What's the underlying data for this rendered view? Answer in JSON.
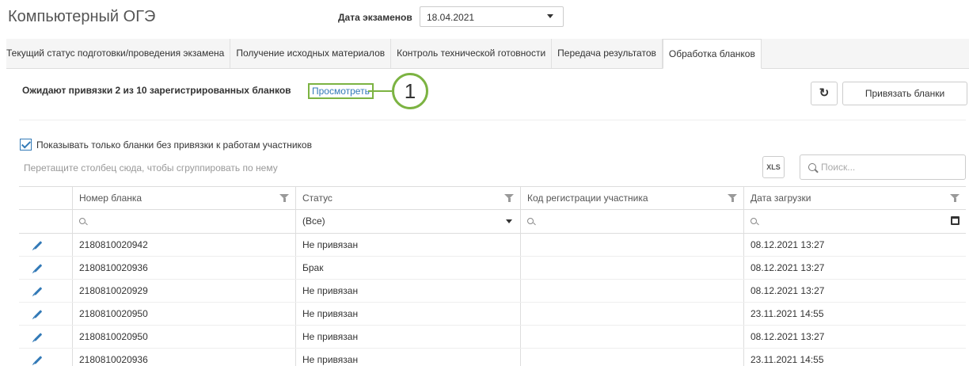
{
  "header": {
    "app_title": "Компьютерный ОГЭ",
    "date_label": "Дата экзаменов",
    "date_value": "18.04.2021"
  },
  "tabs": [
    {
      "label": "Текущий статус подготовки/проведения экзамена",
      "active": false
    },
    {
      "label": "Получение исходных материалов",
      "active": false
    },
    {
      "label": "Контроль технической готовности",
      "active": false
    },
    {
      "label": "Передача результатов",
      "active": false
    },
    {
      "label": "Обработка бланков",
      "active": true
    }
  ],
  "panel": {
    "pending_text": "Ожидают привязки 2 из 10 зарегистрированных бланков",
    "view_link": "Просмотреть",
    "callout_number": "1",
    "bind_button": "Привязать бланки",
    "only_unbound_label": "Показывать только бланки без привязки к работам участников",
    "group_hint": "Перетащите столбец сюда, чтобы сгруппировать по нему",
    "export_icon_text": "XLS",
    "search_placeholder": "Поиск..."
  },
  "table": {
    "columns": [
      "Номер бланка",
      "Статус",
      "Код регистрации участника",
      "Дата загрузки"
    ],
    "status_filter": "(Все)",
    "rows": [
      {
        "number": "2180810020942",
        "status": "Не привязан",
        "code": "",
        "date": "08.12.2021 13:27"
      },
      {
        "number": "2180810020936",
        "status": "Брак",
        "code": "",
        "date": "08.12.2021 13:27"
      },
      {
        "number": "2180810020929",
        "status": "Не привязан",
        "code": "",
        "date": "08.12.2021 13:27"
      },
      {
        "number": "2180810020950",
        "status": "Не привязан",
        "code": "",
        "date": "23.11.2021 14:55"
      },
      {
        "number": "2180810020950",
        "status": "Не привязан",
        "code": "",
        "date": "08.12.2021 13:27"
      },
      {
        "number": "2180810020936",
        "status": "Не привязан",
        "code": "",
        "date": "23.11.2021 14:55"
      }
    ]
  },
  "colors": {
    "accent": "#337ab7",
    "callout": "#7cb342"
  }
}
